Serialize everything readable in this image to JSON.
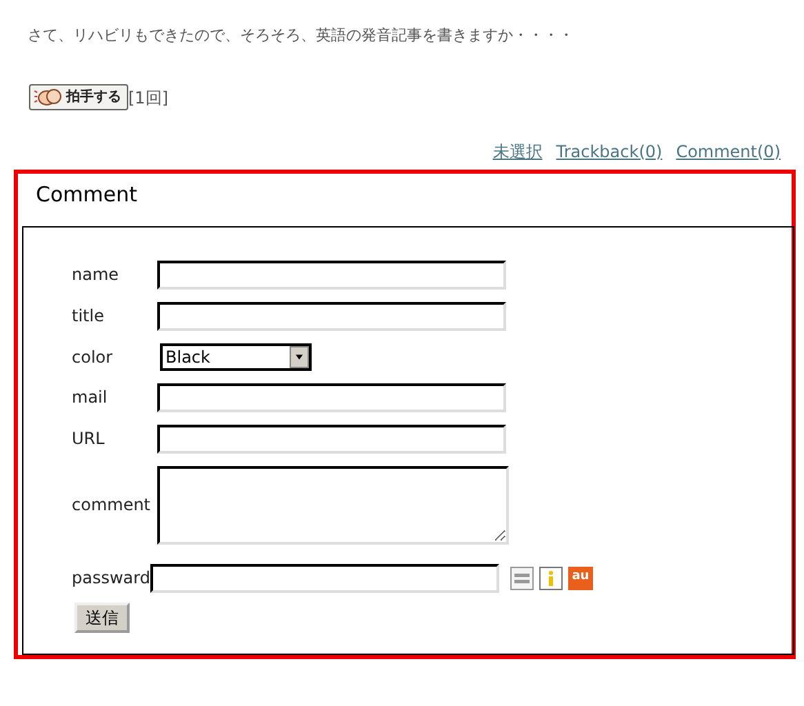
{
  "intro": "さて、リハビリもできたので、そろそろ、英語の発音記事を書きますか・・・・",
  "clap": {
    "label": "拍手する",
    "count": "[1回]"
  },
  "links": [
    "未選択",
    "Trackback(0)",
    "Comment(0)"
  ],
  "comment_form": {
    "title": "Comment",
    "fields": [
      {
        "kind": "text",
        "label": "name"
      },
      {
        "kind": "text",
        "label": "title"
      },
      {
        "kind": "select",
        "label": "color",
        "value": "Black"
      },
      {
        "kind": "text",
        "label": "mail"
      },
      {
        "kind": "text",
        "label": "URL"
      },
      {
        "kind": "textarea",
        "label": "comment"
      },
      {
        "kind": "password",
        "label": "passward"
      }
    ],
    "carrier_logo": "au",
    "submit": "送信"
  }
}
